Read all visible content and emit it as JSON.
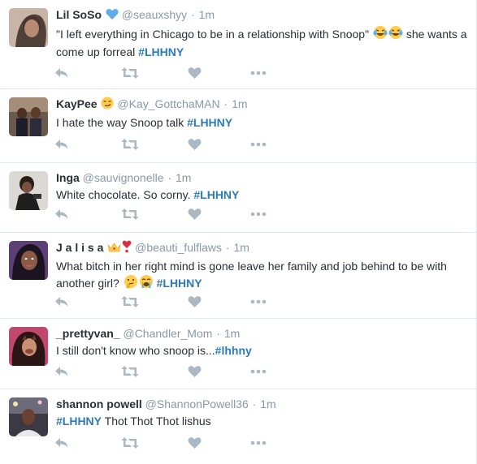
{
  "tweets": [
    {
      "fullname": "Lil SoSo",
      "username": "@seauxshyy",
      "separator": "·",
      "time": "1m",
      "name_emoji": "blue-heart",
      "text_before": "\"I left everything in Chicago to be in a relationship with Snoop\" ",
      "text_emojis": [
        "tears-of-joy",
        "tears-of-joy"
      ],
      "text_after": " she wants a come up forreal ",
      "hashtag": "#LHHNY",
      "text_end": ""
    },
    {
      "fullname": "KayPee",
      "username": "@Kay_GottchaMAN",
      "separator": "·",
      "time": "1m",
      "name_emoji": "smirk",
      "text_before": "I hate the way Snoop talk ",
      "hashtag": "#LHHNY",
      "text_end": ""
    },
    {
      "fullname": "Inga",
      "username": "@sauvignonelle",
      "separator": "·",
      "time": "1m",
      "text_before": "White chocolate. So corny. ",
      "hashtag": "#LHHNY",
      "text_end": ""
    },
    {
      "fullname": "J a l i s a",
      "username": "@beauti_fulflaws",
      "separator": "·",
      "time": "1m",
      "name_emojis": [
        "crown",
        "heart-exclamation"
      ],
      "text_before": "What bitch in her right mind is gone leave her family and job behind to be with another girl? ",
      "text_emojis": [
        "thinking",
        "crying"
      ],
      "hashtag": "#LHHNY",
      "text_end": ""
    },
    {
      "fullname": "_prettyvan_",
      "username": "@Chandler_Mom",
      "separator": "·",
      "time": "1m",
      "text_before": "I still don't know who snoop is...",
      "hashtag": "#lhhny",
      "text_end": ""
    },
    {
      "fullname": "shannon powell",
      "username": "@ShannonPowell36",
      "separator": "·",
      "time": "1m",
      "text_before": "",
      "hashtag": "#LHHNY",
      "text_end": " Thot Thot Thot lishus"
    }
  ],
  "colors": {
    "icon": "#aab8c2",
    "hashtag": "#2b7bb9",
    "username": "#8899a6",
    "text": "#292f33",
    "divider": "#e1e8ed"
  },
  "action_icons": [
    "reply-icon",
    "retweet-icon",
    "like-icon",
    "more-icon"
  ]
}
